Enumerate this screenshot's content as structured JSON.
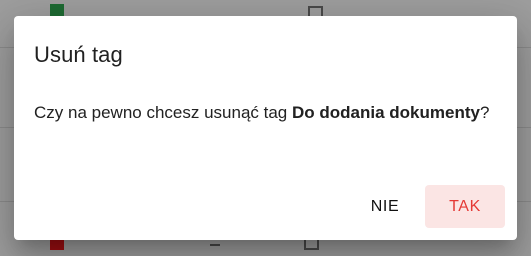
{
  "dialog": {
    "title": "Usuń tag",
    "message_prefix": "Czy na pewno chcesz usunąć tag ",
    "tag_name": "Do dodania dokumenty",
    "message_suffix": "?",
    "buttons": {
      "cancel_label": "NIE",
      "confirm_label": "TAK"
    }
  },
  "colors": {
    "backdrop": "#9e9e9e",
    "confirm_text": "#e53935",
    "confirm_bg": "#fbe5e4"
  }
}
